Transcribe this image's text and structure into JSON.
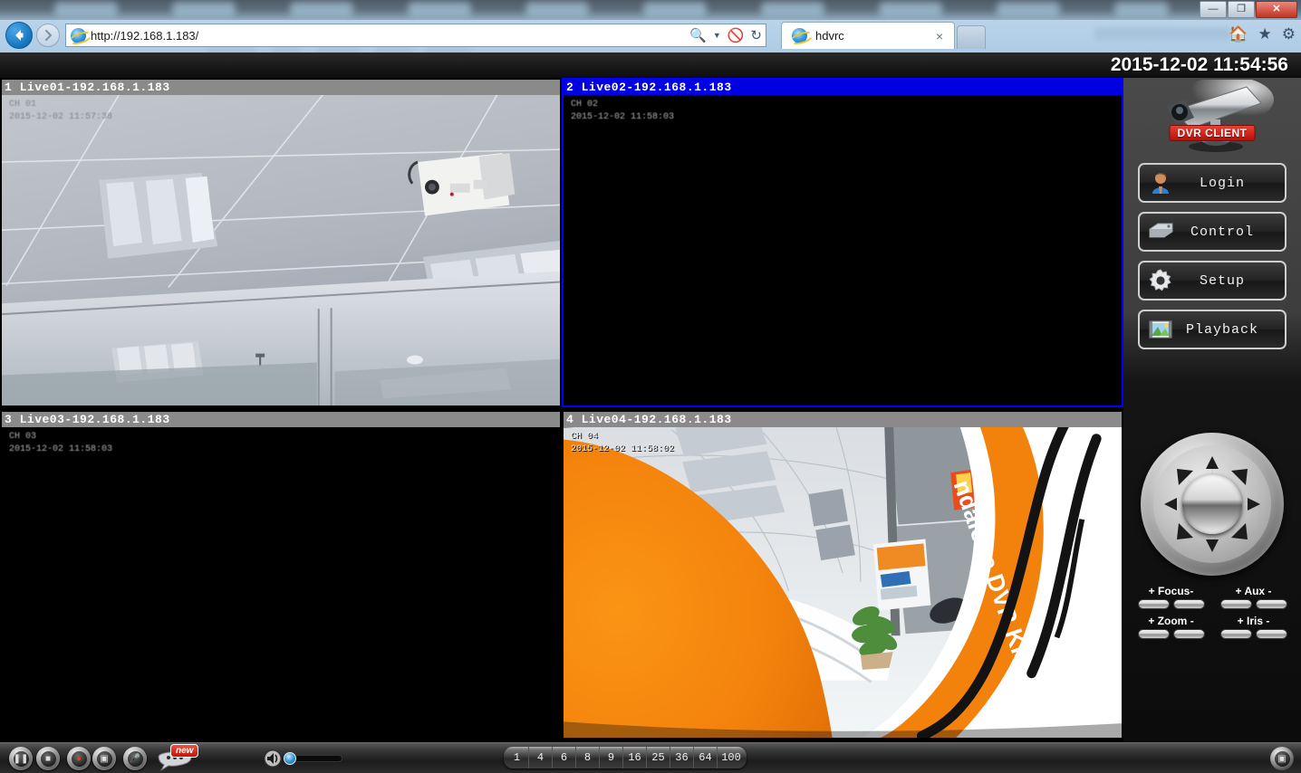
{
  "browser": {
    "url": "http://192.168.1.183/",
    "tab_title": "hdvrc",
    "tab_close_label": "×",
    "new_tab_label": "",
    "back_icon": "back-arrow-icon",
    "forward_icon": "forward-arrow-icon",
    "search_icon": "search-magnifier-icon",
    "stop_icon": "stop-loading-icon",
    "refresh_icon": "refresh-icon",
    "home_icon": "home-icon",
    "favorites_icon": "star-icon",
    "tools_icon": "gear-icon",
    "window_buttons": {
      "minimize": "—",
      "restore": "❐",
      "close": "✕"
    }
  },
  "app": {
    "clock": "2015-12-02 11:54:56",
    "logo_text": "DVR CLIENT",
    "logo_icon": "cctv-camera-icon",
    "buttons": [
      {
        "label": "Login",
        "icon": "user-icon"
      },
      {
        "label": "Control",
        "icon": "device-icon"
      },
      {
        "label": "Setup",
        "icon": "gear-icon"
      },
      {
        "label": "Playback",
        "icon": "picture-icon"
      }
    ],
    "ptz": {
      "joystick_icon": "ptz-joystick",
      "pads": [
        {
          "label_plus": "+",
          "name": "Focus",
          "label_minus": "-"
        },
        {
          "label_plus": "+",
          "name": "Aux",
          "label_minus": "-"
        },
        {
          "label_plus": "+",
          "name": "Zoom",
          "label_minus": "-"
        },
        {
          "label_plus": "+",
          "name": "Iris",
          "label_minus": "-"
        }
      ]
    }
  },
  "cameras": [
    {
      "index": "1",
      "title": "1 Live01-192.168.1.183",
      "osd_channel": "CH 01",
      "osd_time": "2015-12-02 11:57:38",
      "selected": false,
      "scene": "office-ceiling",
      "signal": true
    },
    {
      "index": "2",
      "title": "2 Live02-192.168.1.183",
      "osd_channel": "CH 02",
      "osd_time": "2015-12-02 11:58:03",
      "selected": true,
      "scene": "black",
      "signal": false
    },
    {
      "index": "3",
      "title": "3 Live03-192.168.1.183",
      "osd_channel": "CH 03",
      "osd_time": "2015-12-02 11:58:03",
      "selected": false,
      "scene": "black",
      "signal": false
    },
    {
      "index": "4",
      "title": "4 Live04-192.168.1.183",
      "osd_channel": "CH 04",
      "osd_time": "2015-12-02 11:58:02",
      "selected": false,
      "scene": "fisheye-office",
      "banner_text": "ndalone DVR Ki",
      "signal": true
    }
  ],
  "toolbar": {
    "buttons": [
      {
        "name": "pause-button",
        "icon": "pause-icon"
      },
      {
        "name": "stop-button",
        "icon": "stop-square-icon"
      },
      {
        "name": "record-button",
        "icon": "record-dot-icon"
      },
      {
        "name": "snapshot-button",
        "icon": "snapshot-icon"
      },
      {
        "name": "mic-button",
        "icon": "microphone-icon"
      },
      {
        "name": "chat-button",
        "icon": "chat-bubble-icon"
      }
    ],
    "new_badge": "new",
    "volume_icon": "speaker-icon",
    "volume_value": "0",
    "layout_options": [
      "1",
      "4",
      "6",
      "8",
      "9",
      "16",
      "25",
      "36",
      "64",
      "100"
    ],
    "fullscreen_icon": "fullscreen-icon"
  },
  "colors": {
    "selected_border": "#0000ff",
    "title_bar": "#8a8a8a",
    "accent_red": "#c21508",
    "clock_text": "#ffffff"
  }
}
